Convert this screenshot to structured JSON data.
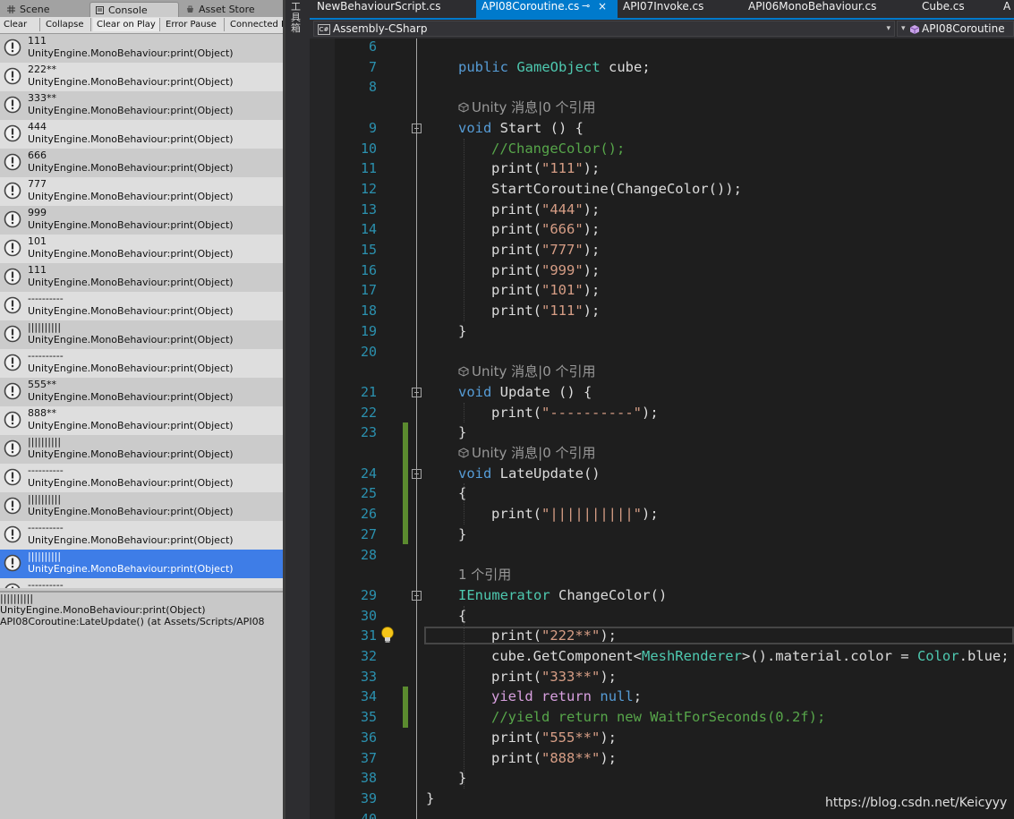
{
  "unity": {
    "tabs": {
      "scene": "Scene",
      "console": "Console",
      "asset_store": "Asset Store"
    },
    "toolbar": {
      "clear": "Clear",
      "collapse": "Collapse",
      "clear_on_play": "Clear on Play",
      "error_pause": "Error Pause",
      "connected": "Connected P"
    },
    "logs": [
      {
        "msg": "111",
        "src": "UnityEngine.MonoBehaviour:print(Object)"
      },
      {
        "msg": "222**",
        "src": "UnityEngine.MonoBehaviour:print(Object)"
      },
      {
        "msg": "333**",
        "src": "UnityEngine.MonoBehaviour:print(Object)"
      },
      {
        "msg": "444",
        "src": "UnityEngine.MonoBehaviour:print(Object)"
      },
      {
        "msg": "666",
        "src": "UnityEngine.MonoBehaviour:print(Object)"
      },
      {
        "msg": "777",
        "src": "UnityEngine.MonoBehaviour:print(Object)"
      },
      {
        "msg": "999",
        "src": "UnityEngine.MonoBehaviour:print(Object)"
      },
      {
        "msg": "101",
        "src": "UnityEngine.MonoBehaviour:print(Object)"
      },
      {
        "msg": "111",
        "src": "UnityEngine.MonoBehaviour:print(Object)"
      },
      {
        "msg": "----------",
        "src": "UnityEngine.MonoBehaviour:print(Object)"
      },
      {
        "msg": "||||||||||",
        "src": "UnityEngine.MonoBehaviour:print(Object)"
      },
      {
        "msg": "----------",
        "src": "UnityEngine.MonoBehaviour:print(Object)"
      },
      {
        "msg": "555**",
        "src": "UnityEngine.MonoBehaviour:print(Object)"
      },
      {
        "msg": "888**",
        "src": "UnityEngine.MonoBehaviour:print(Object)"
      },
      {
        "msg": "||||||||||",
        "src": "UnityEngine.MonoBehaviour:print(Object)"
      },
      {
        "msg": "----------",
        "src": "UnityEngine.MonoBehaviour:print(Object)"
      },
      {
        "msg": "||||||||||",
        "src": "UnityEngine.MonoBehaviour:print(Object)"
      },
      {
        "msg": "----------",
        "src": "UnityEngine.MonoBehaviour:print(Object)"
      },
      {
        "msg": "||||||||||",
        "src": "UnityEngine.MonoBehaviour:print(Object)"
      },
      {
        "msg": "----------",
        "src": ""
      }
    ],
    "detail": {
      "line1": "||||||||||",
      "line2": "UnityEngine.MonoBehaviour:print(Object)",
      "line3": "API08Coroutine:LateUpdate() (at Assets/Scripts/API08"
    }
  },
  "vstrip_label": "工具箱",
  "editor_tabs": [
    {
      "label": "NewBehaviourScript.cs"
    },
    {
      "label": "API08Coroutine.cs",
      "pin": "⊸",
      "close": "×"
    },
    {
      "label": "API07Invoke.cs"
    },
    {
      "label": "API06MonoBehaviour.cs"
    },
    {
      "label": "Cube.cs"
    },
    {
      "label": "A"
    }
  ],
  "navbar": {
    "project": "Assembly-CSharp",
    "cs_badge": "C#",
    "class": "API08Coroutine"
  },
  "codelens": {
    "unity_msg": "Unity 消息|0 个引用",
    "one_ref": "1 个引用"
  },
  "line_numbers": [
    "6",
    "7",
    "8",
    "9",
    "10",
    "11",
    "12",
    "13",
    "14",
    "15",
    "16",
    "17",
    "18",
    "19",
    "20",
    "21",
    "22",
    "23",
    "24",
    "25",
    "26",
    "27",
    "28",
    "29",
    "30",
    "31",
    "32",
    "33",
    "34",
    "35",
    "36",
    "37",
    "38",
    "39",
    "40"
  ],
  "watermark": "https://blog.csdn.net/Keicyyy",
  "colors": {
    "keyword": "#569cd6",
    "type": "#4ec9b0",
    "string": "#d69d85",
    "comment": "#57a64a",
    "line_number": "#2b91af",
    "tab_active": "#007acc",
    "selected_row": "#3e7de7"
  }
}
